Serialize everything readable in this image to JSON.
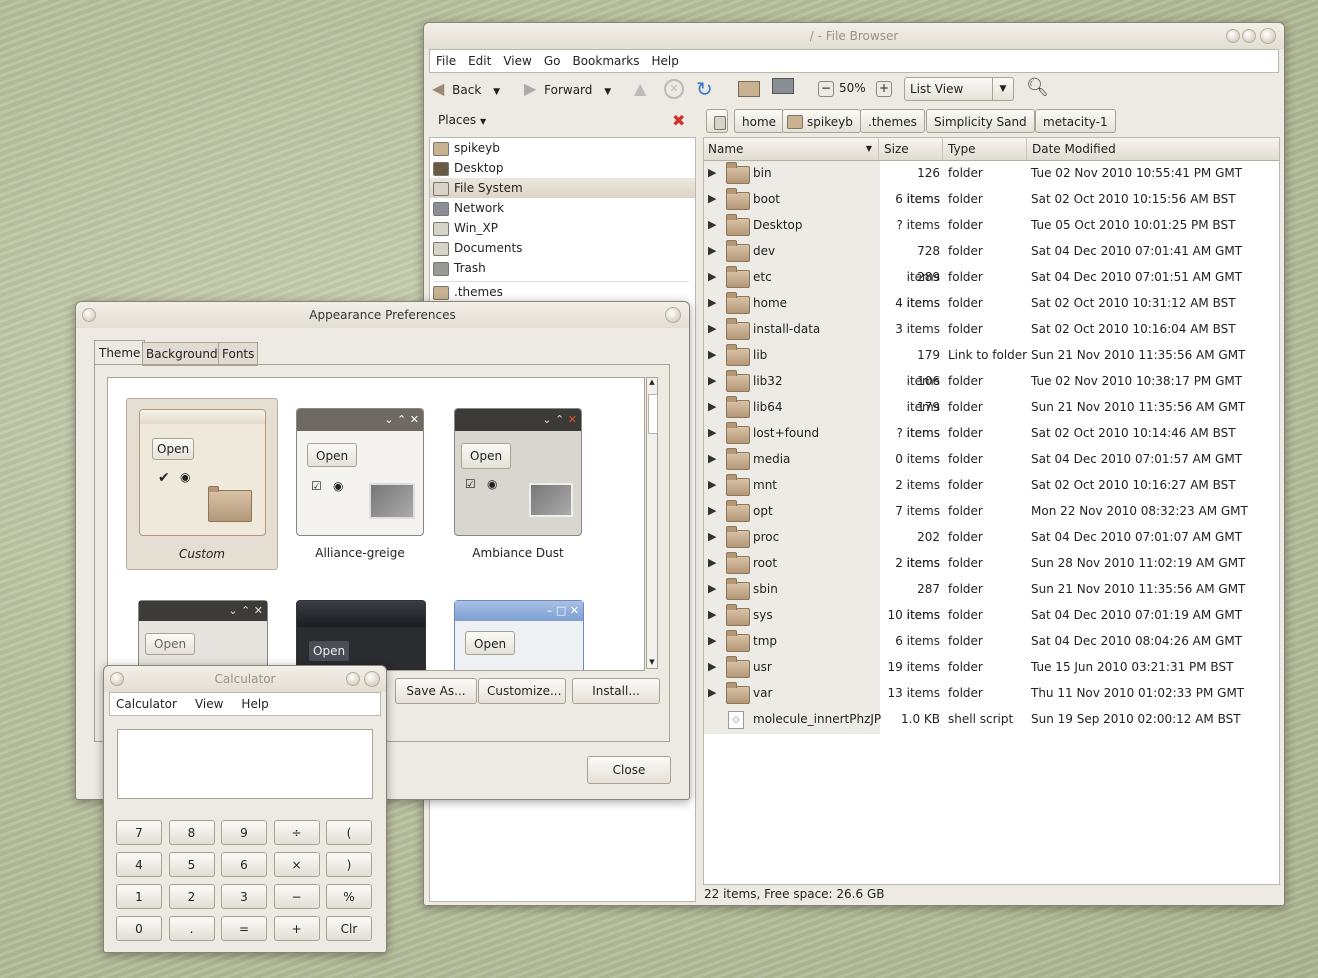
{
  "file_browser": {
    "title": "/ - File Browser",
    "menu": [
      "File",
      "Edit",
      "View",
      "Go",
      "Bookmarks",
      "Help"
    ],
    "toolbar": {
      "back": "Back",
      "forward": "Forward",
      "zoom": "50%",
      "view_select": "List View"
    },
    "places_label": "Places",
    "places": [
      "spikeyb",
      "Desktop",
      "File System",
      "Network",
      "Win_XP",
      "Documents",
      "Trash",
      ".themes"
    ],
    "breadcrumbs": [
      "home",
      "spikeyb",
      ".themes",
      "Simplicity Sand",
      "metacity-1"
    ],
    "columns": {
      "name": "Name",
      "size": "Size",
      "type": "Type",
      "date": "Date Modified"
    },
    "rows": [
      {
        "name": "bin",
        "size": "126 items",
        "type": "folder",
        "date": "Tue 02 Nov 2010 10:55:41 PM GMT"
      },
      {
        "name": "boot",
        "size": "6 items",
        "type": "folder",
        "date": "Sat 02 Oct 2010 10:15:56 AM BST"
      },
      {
        "name": "Desktop",
        "size": "? items",
        "type": "folder",
        "date": "Tue 05 Oct 2010 10:01:25 PM BST"
      },
      {
        "name": "dev",
        "size": "728 items",
        "type": "folder",
        "date": "Sat 04 Dec 2010 07:01:41 AM GMT"
      },
      {
        "name": "etc",
        "size": "289 items",
        "type": "folder",
        "date": "Sat 04 Dec 2010 07:01:51 AM GMT"
      },
      {
        "name": "home",
        "size": "4 items",
        "type": "folder",
        "date": "Sat 02 Oct 2010 10:31:12 AM BST"
      },
      {
        "name": "install-data",
        "size": "3 items",
        "type": "folder",
        "date": "Sat 02 Oct 2010 10:16:04 AM BST"
      },
      {
        "name": "lib",
        "size": "179 items",
        "type": "Link to folder",
        "date": "Sun 21 Nov 2010 11:35:56 AM GMT"
      },
      {
        "name": "lib32",
        "size": "106 items",
        "type": "folder",
        "date": "Tue 02 Nov 2010 10:38:17 PM GMT"
      },
      {
        "name": "lib64",
        "size": "179 items",
        "type": "folder",
        "date": "Sun 21 Nov 2010 11:35:56 AM GMT"
      },
      {
        "name": "lost+found",
        "size": "? items",
        "type": "folder",
        "date": "Sat 02 Oct 2010 10:14:46 AM BST"
      },
      {
        "name": "media",
        "size": "0 items",
        "type": "folder",
        "date": "Sat 04 Dec 2010 07:01:57 AM GMT"
      },
      {
        "name": "mnt",
        "size": "2 items",
        "type": "folder",
        "date": "Sat 02 Oct 2010 10:16:27 AM BST"
      },
      {
        "name": "opt",
        "size": "7 items",
        "type": "folder",
        "date": "Mon 22 Nov 2010 08:32:23 AM GMT"
      },
      {
        "name": "proc",
        "size": "202 items",
        "type": "folder",
        "date": "Sat 04 Dec 2010 07:01:07 AM GMT"
      },
      {
        "name": "root",
        "size": "2 items",
        "type": "folder",
        "date": "Sun 28 Nov 2010 11:02:19 AM GMT"
      },
      {
        "name": "sbin",
        "size": "287 items",
        "type": "folder",
        "date": "Sun 21 Nov 2010 11:35:56 AM GMT"
      },
      {
        "name": "sys",
        "size": "10 items",
        "type": "folder",
        "date": "Sat 04 Dec 2010 07:01:19 AM GMT"
      },
      {
        "name": "tmp",
        "size": "6 items",
        "type": "folder",
        "date": "Sat 04 Dec 2010 08:04:26 AM GMT"
      },
      {
        "name": "usr",
        "size": "19 items",
        "type": "folder",
        "date": "Tue 15 Jun 2010 03:21:31 PM BST"
      },
      {
        "name": "var",
        "size": "13 items",
        "type": "folder",
        "date": "Thu 11 Nov 2010 01:02:33 PM GMT"
      },
      {
        "name": "molecule_innertPhzJP",
        "size": "1.0 KB",
        "type": "shell script",
        "date": "Sun 19 Sep 2010 02:00:12 AM BST"
      }
    ],
    "status": "22 items, Free space: 26.6 GB"
  },
  "appearance": {
    "title": "Appearance Preferences",
    "tabs": [
      "Theme",
      "Background",
      "Fonts"
    ],
    "themes": [
      "Custom",
      "Alliance-greige",
      "Ambiance Dust"
    ],
    "thumb_open_label": "Open",
    "buttons": {
      "save_as": "Save As...",
      "customize": "Customize...",
      "install": "Install...",
      "close": "Close"
    }
  },
  "calculator": {
    "title": "Calculator",
    "menu": [
      "Calculator",
      "View",
      "Help"
    ],
    "display": "",
    "keys": [
      [
        "7",
        "8",
        "9",
        "÷",
        "("
      ],
      [
        "4",
        "5",
        "6",
        "×",
        ")"
      ],
      [
        "1",
        "2",
        "3",
        "−",
        "%"
      ],
      [
        "0",
        ".",
        "=",
        "+",
        "Clr"
      ]
    ]
  }
}
